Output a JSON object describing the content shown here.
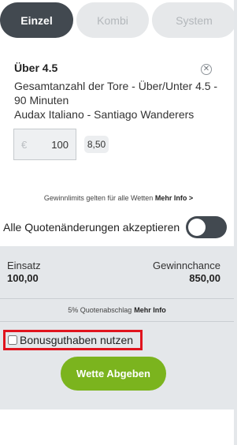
{
  "tabs": [
    {
      "label": "Einzel",
      "active": true
    },
    {
      "label": "Kombi",
      "active": false
    },
    {
      "label": "System",
      "active": false
    }
  ],
  "bet": {
    "selection": "Über 4.5",
    "market": "Gesamtanzahl der Tore - Über/Unter 4.5 - 90 Minuten",
    "event": "Audax Italiano - Santiago Wanderers",
    "close_icon": "close-circle-icon",
    "stake_currency": "€",
    "stake_value": "100",
    "odds": "8,50"
  },
  "limits": {
    "text": "Gewinnlimits gelten für alle Wetten",
    "link": "Mehr Info >"
  },
  "accept_changes": {
    "label": "Alle Quotenänderungen akzeptieren",
    "toggle_on": false
  },
  "summary": {
    "stake_label": "Einsatz",
    "stake_value": "100,00",
    "win_label": "Gewinnchance",
    "win_value": "850,00",
    "discount_text": "5% Quotenabschlag",
    "discount_link": "Mehr Info"
  },
  "bonus": {
    "label": "Bonusguthaben nutzen",
    "checked": false
  },
  "submit": {
    "label": "Wette Abgeben"
  },
  "colors": {
    "tab_active_bg": "#424950",
    "tab_inactive_bg": "#e6e8ea",
    "submit_bg": "#7bb41e",
    "summary_bg": "#e4e7ea",
    "highlight_border": "#e0141e"
  }
}
